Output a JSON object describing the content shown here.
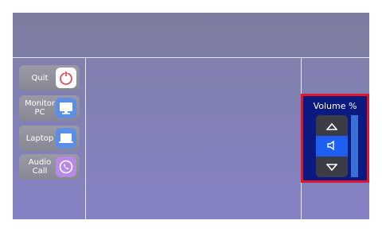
{
  "sources": [
    {
      "label": "Quit",
      "icon": "power-icon"
    },
    {
      "label": "Monitor\nPC",
      "icon": "monitor-icon"
    },
    {
      "label": "Laptop",
      "icon": "laptop-icon"
    },
    {
      "label": "Audio\nCall",
      "icon": "phone-icon"
    }
  ],
  "volume": {
    "title": "Volume %",
    "up_icon": "triangle-up-icon",
    "mute_icon": "speaker-icon",
    "down_icon": "triangle-down-icon",
    "level_percent": 100
  },
  "colors": {
    "accent_blue": "#1e5ef0",
    "highlight_border": "#e0142c",
    "volume_bg": "#0b1a80"
  }
}
